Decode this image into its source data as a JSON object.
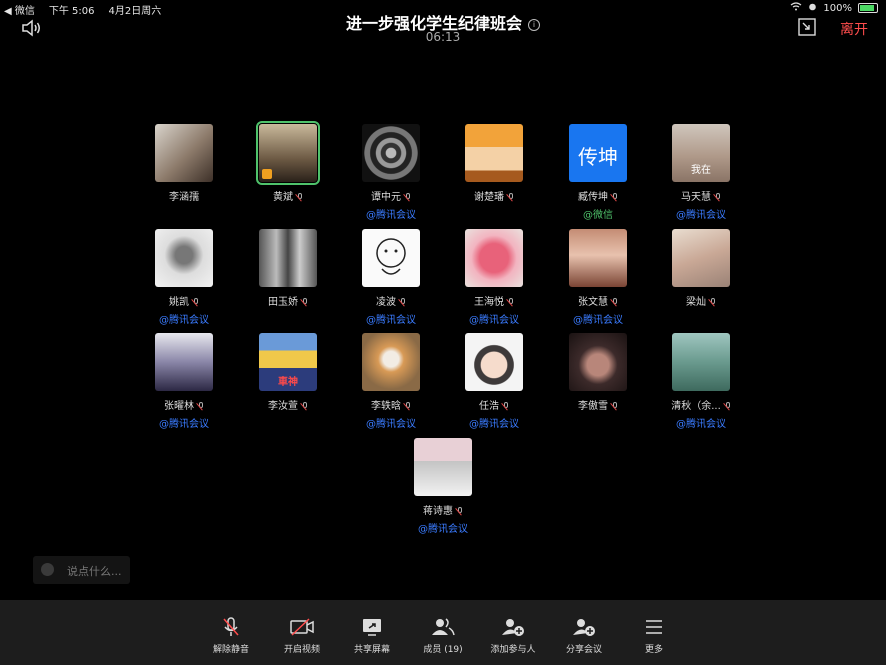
{
  "status_bar": {
    "back_app": "◀ 微信",
    "time": "下午 5:06",
    "date": "4月2日周六",
    "battery": "100%"
  },
  "header": {
    "title": "进一步强化学生纪律班会",
    "elapsed": "06:13",
    "leave_label": "离开"
  },
  "participants": [
    {
      "name": "李涵孺",
      "source": "",
      "muted": false
    },
    {
      "name": "黄斌",
      "source": "",
      "muted": true,
      "active_speaker": true
    },
    {
      "name": "谭中元",
      "source": "@腾讯会议",
      "muted": true
    },
    {
      "name": "谢楚璠",
      "source": "",
      "muted": true
    },
    {
      "name": "臧传坤",
      "source": "@微信",
      "muted": true,
      "avatar_text": "传坤"
    },
    {
      "name": "马天慧",
      "source": "@腾讯会议",
      "muted": true,
      "avatar_text": "我在"
    },
    {
      "name": "姚凯",
      "source": "@腾讯会议",
      "muted": true
    },
    {
      "name": "田玉娇",
      "source": "",
      "muted": true
    },
    {
      "name": "凌波",
      "source": "@腾讯会议",
      "muted": true
    },
    {
      "name": "王海悦",
      "source": "@腾讯会议",
      "muted": true
    },
    {
      "name": "张文慧",
      "source": "@腾讯会议",
      "muted": true
    },
    {
      "name": "梁灿",
      "source": "",
      "muted": true
    },
    {
      "name": "张曜林",
      "source": "@腾讯会议",
      "muted": true
    },
    {
      "name": "李汝萱",
      "source": "",
      "muted": true,
      "avatar_text": "車神"
    },
    {
      "name": "李轶晗",
      "source": "@腾讯会议",
      "muted": true
    },
    {
      "name": "任浩",
      "source": "@腾讯会议",
      "muted": true
    },
    {
      "name": "李傲雪",
      "source": "",
      "muted": true
    },
    {
      "name": "清秋（余...",
      "source": "@腾讯会议",
      "muted": true
    },
    {
      "name": "蒋诗惠",
      "source": "@腾讯会议",
      "muted": true
    }
  ],
  "chat": {
    "placeholder": "说点什么..."
  },
  "toolbar": {
    "unmute": "解除静音",
    "start_video": "开启视频",
    "share_screen": "共享屏幕",
    "members": "成员 (19)",
    "add_participant": "添加参与人",
    "share_meeting": "分享会议",
    "more": "更多"
  },
  "colors": {
    "background": "#000000",
    "toolbar": "#1d1d1d",
    "leave": "#ff4d4d",
    "source_link": "#3a7bff",
    "active_speaker": "#4fc26b"
  }
}
